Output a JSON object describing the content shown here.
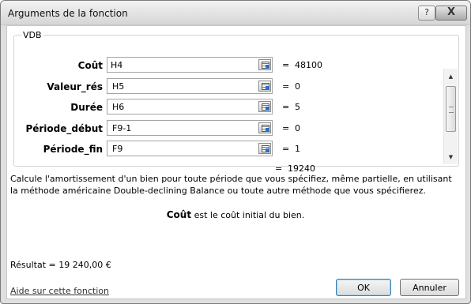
{
  "dialog": {
    "title": "Arguments de la fonction",
    "help_button": "?",
    "close_button": "X"
  },
  "function": {
    "name": "VDB",
    "arguments": [
      {
        "label": "Coût",
        "value": "H4",
        "result": "48100"
      },
      {
        "label": "Valeur_rés",
        "value": "H5",
        "result": "0"
      },
      {
        "label": "Durée",
        "value": "H6",
        "result": "5"
      },
      {
        "label": "Période_début",
        "value": "F9-1",
        "result": "0"
      },
      {
        "label": "Période_fin",
        "value": "F9",
        "result": "1"
      }
    ],
    "equals_sign": "=",
    "function_result": "19240",
    "description": "Calcule l'amortissement d'un bien pour toute période que vous spécifiez, même partielle, en utilisant la méthode américaine Double-declining Balance ou toute autre méthode que vous spécifierez.",
    "current_argument_name": "Coût",
    "current_argument_help": "est le coût initial du bien."
  },
  "result": {
    "label": "Résultat =",
    "value": "19 240,00 €"
  },
  "footer": {
    "help_link": "Aide sur cette fonction",
    "ok_label": "OK",
    "cancel_label": "Annuler"
  }
}
